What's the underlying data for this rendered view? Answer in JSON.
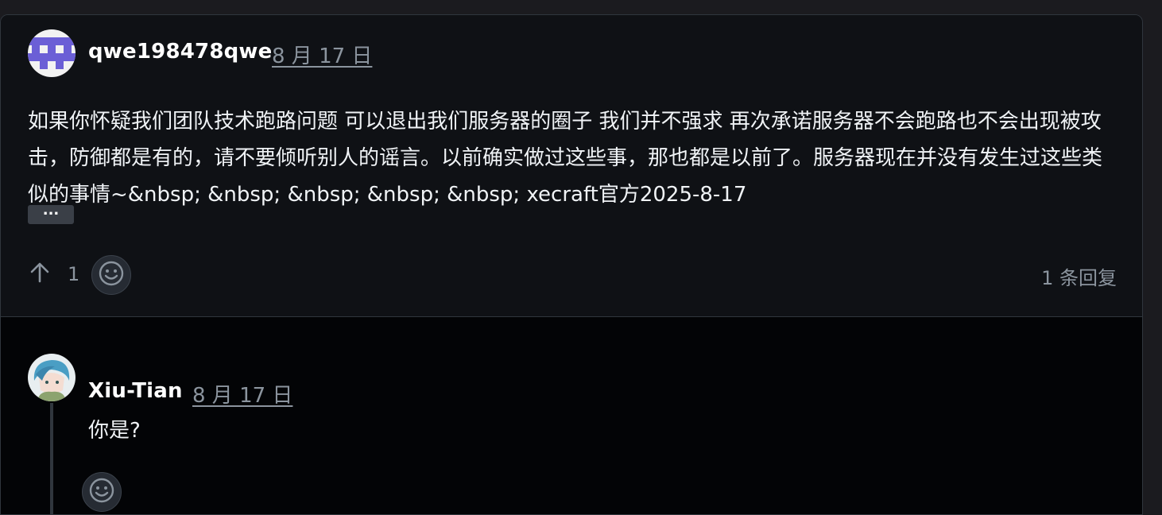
{
  "comment": {
    "author": "qwe198478qwe",
    "date": "8 月 17 日",
    "body": "如果你怀疑我们团队技术跑路问题 可以退出我们服务器的圈子 我们并不强求 再次承诺服务器不会跑路也不会出现被攻击，防御都是有的，请不要倾听别人的谣言。以前确实做过这些事，那也都是以前了。服务器现在并没有发生过这些类似的事情~&nbsp; &nbsp; &nbsp; &nbsp; &nbsp; xecraft官方2025-8-17",
    "more_label": "...",
    "upvotes": "1",
    "reply_count": "1 条回复",
    "icons": {
      "avatar": "identicon-avatar",
      "upvote": "arrow-up-icon",
      "emoji": "smiley-icon"
    }
  },
  "reply": {
    "author": "Xiu-Tian",
    "date": "8 月 17 日",
    "body": "你是?",
    "icons": {
      "avatar": "anime-avatar",
      "emoji": "smiley-icon"
    }
  },
  "colors": {
    "background": "#0f1115",
    "reply_background": "#030406",
    "border": "#30363d",
    "muted_text": "#8b949e",
    "identicon": "#6b5fd6"
  }
}
